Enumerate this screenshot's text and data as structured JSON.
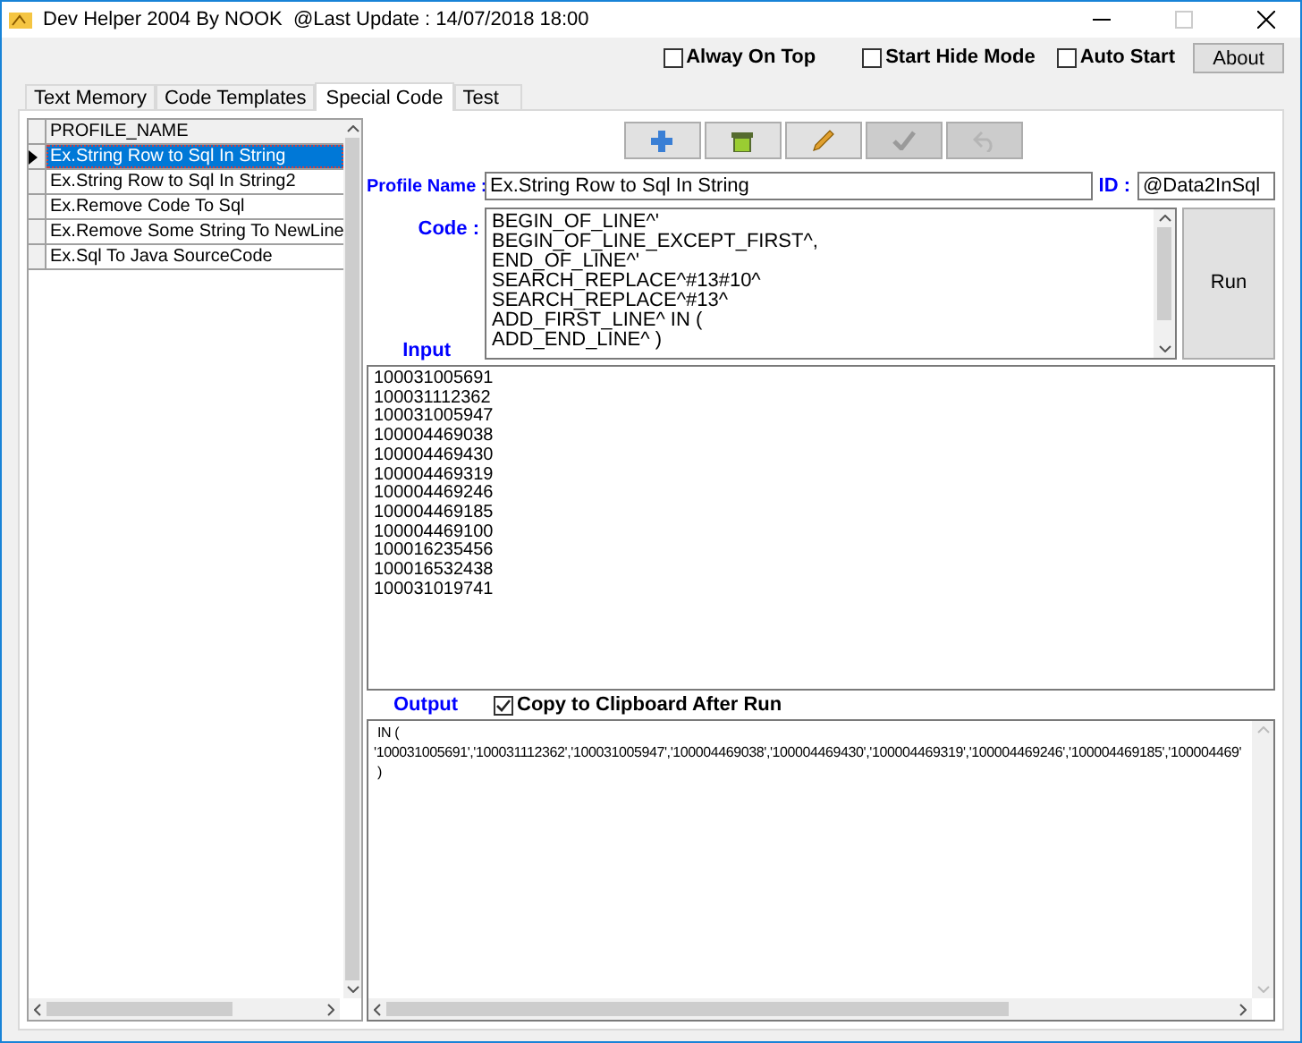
{
  "window": {
    "title": "Dev Helper 2004 By NOOK  @Last Update : 14/07/2018 18:00"
  },
  "top_options": [
    {
      "label": "Alway On Top",
      "checked": false
    },
    {
      "label": "Start Hide Mode",
      "checked": false
    },
    {
      "label": "Auto Start",
      "checked": false
    }
  ],
  "about_button": "About",
  "tabs": [
    {
      "label": "Text Memory",
      "selected": false
    },
    {
      "label": "Code Templates",
      "selected": false
    },
    {
      "label": "Special Code",
      "selected": true
    },
    {
      "label": "Test",
      "selected": false
    }
  ],
  "profiles": {
    "column": "PROFILE_NAME",
    "rows": [
      {
        "name": "Ex.String Row to Sql In String",
        "selected": true
      },
      {
        "name": "Ex.String Row to Sql In String2",
        "selected": false
      },
      {
        "name": "Ex.Remove Code To Sql",
        "selected": false
      },
      {
        "name": "Ex.Remove Some String To NewLine",
        "selected": false
      },
      {
        "name": "Ex.Sql To Java SourceCode",
        "selected": false
      }
    ]
  },
  "toolbar": [
    {
      "kind": "add",
      "disabled": false
    },
    {
      "kind": "delete",
      "disabled": false
    },
    {
      "kind": "edit",
      "disabled": false
    },
    {
      "kind": "save",
      "disabled": true
    },
    {
      "kind": "undo",
      "disabled": true
    }
  ],
  "profile_name": {
    "label": "Profile Name :",
    "value": "Ex.String Row to Sql In String"
  },
  "id": {
    "label": "ID :",
    "value": "@Data2InSql"
  },
  "code": {
    "label": "Code :",
    "lines": [
      "BEGIN_OF_LINE^'",
      "BEGIN_OF_LINE_EXCEPT_FIRST^,",
      "END_OF_LINE^'",
      "SEARCH_REPLACE^#13#10^",
      "SEARCH_REPLACE^#13^",
      "ADD_FIRST_LINE^ IN (",
      "ADD_END_LINE^ )"
    ]
  },
  "run_button": "Run",
  "input": {
    "label": "Input",
    "lines": [
      "100031005691",
      "100031112362",
      "100031005947",
      "100004469038",
      "100004469430",
      "100004469319",
      "100004469246",
      "100004469185",
      "100004469100",
      "100016235456",
      "100016532438",
      "100031019741"
    ]
  },
  "output": {
    "label": "Output",
    "copy_option": {
      "label": "Copy to Clipboard After Run",
      "checked": true
    },
    "lines": [
      " IN (",
      "'100031005691','100031112362','100031005947','100004469038','100004469430','100004469319','100004469246','100004469185','100004469'",
      " )"
    ]
  }
}
